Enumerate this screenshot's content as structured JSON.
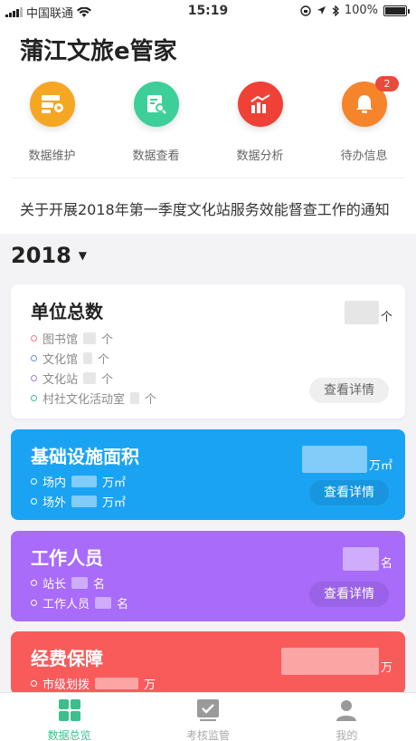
{
  "status_bar": {
    "carrier": "中国联通",
    "time": "15:19",
    "battery": "100%"
  },
  "app_title": "蒲江文旅e管家",
  "shortcuts": [
    {
      "label": "数据维护",
      "icon": "data-maintenance-icon",
      "color": "#f5a623"
    },
    {
      "label": "数据查看",
      "icon": "data-view-icon",
      "color": "#3ccf9a"
    },
    {
      "label": "数据分析",
      "icon": "data-analysis-icon",
      "color": "#ef4136"
    },
    {
      "label": "待办信息",
      "icon": "bell-icon",
      "color": "#f5842a",
      "badge": "2"
    }
  ],
  "notice": "关于开展2018年第一季度文化站服务效能督查工作的通知",
  "year": "2018",
  "cards": {
    "units": {
      "title": "单位总数",
      "unit": "个",
      "items": [
        {
          "label": "图书馆",
          "suffix": "个",
          "dot": "#f07b7b"
        },
        {
          "label": "文化馆",
          "suffix": "个",
          "dot": "#6c8df5"
        },
        {
          "label": "文化站",
          "suffix": "个",
          "dot": "#a37bf3"
        },
        {
          "label": "村社文化活动室",
          "suffix": "个",
          "dot": "#3cbf8c"
        }
      ],
      "detail": "查看详情"
    },
    "facility": {
      "title": "基础设施面积",
      "unit": "万㎡",
      "items": [
        {
          "label": "场内",
          "suffix": "万㎡"
        },
        {
          "label": "场外",
          "suffix": "万㎡"
        }
      ],
      "detail": "查看详情"
    },
    "staff": {
      "title": "工作人员",
      "unit": "名",
      "items": [
        {
          "label": "站长",
          "suffix": "名"
        },
        {
          "label": "工作人员",
          "suffix": "名"
        }
      ],
      "detail": "查看详情"
    },
    "funding": {
      "title": "经费保障",
      "unit": "万",
      "items": [
        {
          "label": "市级划拨",
          "suffix": "万"
        }
      ]
    }
  },
  "tabs": [
    {
      "label": "数据总览",
      "icon": "grid-icon",
      "active": true
    },
    {
      "label": "考核监管",
      "icon": "checkbox-icon",
      "active": false
    },
    {
      "label": "我的",
      "icon": "person-icon",
      "active": false
    }
  ]
}
